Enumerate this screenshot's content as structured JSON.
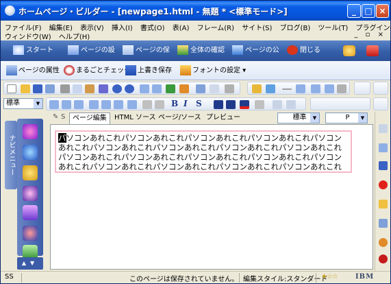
{
  "window": {
    "title": "ホームページ・ビルダー - [newpage1.html - 無題 * <標準モード>]",
    "buttons": {
      "minimize": "_",
      "maximize": "□",
      "close": "×"
    }
  },
  "menubar": {
    "row1": [
      "ファイル(F)",
      "編集(E)",
      "表示(V)",
      "挿入(I)",
      "書式(O)",
      "表(A)",
      "フレーム(R)",
      "サイト(S)",
      "ブログ(B)",
      "ツール(T)",
      "プラグイン(P)"
    ],
    "row2": [
      "ウィンドウ(W)",
      "ヘルプ(H)"
    ],
    "mdi_controls": "_ ▫ ×"
  },
  "taskbar": {
    "items": [
      {
        "label": "スタート",
        "icon": "sparkle-icon"
      },
      {
        "label": "ページの設",
        "icon": "page-settings-icon"
      },
      {
        "label": "ページの保",
        "icon": "save-page-icon"
      },
      {
        "label": "全体の確認",
        "icon": "check-all-icon"
      },
      {
        "label": "ページの公",
        "icon": "publish-icon"
      },
      {
        "label": "閉じる",
        "icon": "close-x-icon"
      }
    ]
  },
  "pagebar": {
    "items": [
      {
        "label": "ページの属性",
        "icon": "page-attr-icon"
      },
      {
        "label": "まるごとチェック",
        "icon": "check-circle-icon"
      },
      {
        "label": "上書き保存",
        "icon": "save-icon"
      },
      {
        "label": "フォントの設定 ▾",
        "icon": "font-icon"
      }
    ]
  },
  "format_toolbar": {
    "style_combo": "標準",
    "bold": "B",
    "italic": "I",
    "strike": "S"
  },
  "editor": {
    "tabs": [
      "ページ編集",
      "HTML ソース",
      "ページ/ソース",
      "プレビュー"
    ],
    "style_select": "標準",
    "tag_select": "P",
    "cursor_char": "パ",
    "body_text": "ソコンあれこれパソコンあれこれパソコンあれこれパソコンあれこれパソコンあれこれパソコンあれこれパソコンあれこれパソコンあれこれパソコンあれこれパソコンあれこれパソコンあれこれパソコンあれこれパソコンあれこれパソコンあれこれパソコンあれこれパソコンあれこれパソコンあれこれパソコンあれこれ"
  },
  "sidebar": {
    "nav_tab_label": "ナビメニュー"
  },
  "statusbar": {
    "mode": "SS",
    "message": "このページは保存されていません。",
    "edit_style": "編集スタイル:スタンダード",
    "brand": "IBM"
  }
}
